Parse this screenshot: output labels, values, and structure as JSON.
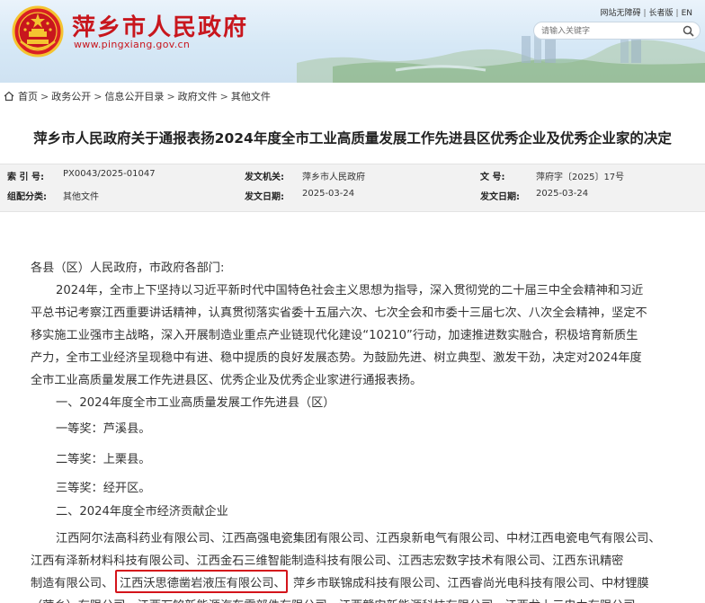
{
  "header": {
    "site_title": "萍乡市人民政府",
    "site_url": "www.pingxiang.gov.cn",
    "top_links": [
      "网站无障碍",
      "长者版",
      "EN"
    ],
    "search_placeholder": "请输入关键字",
    "brand_color": "#c8161d"
  },
  "breadcrumb": {
    "items": [
      "首页",
      "政务公开",
      "信息公开目录",
      "政府文件",
      "其他文件"
    ],
    "separator": ">"
  },
  "article": {
    "title": "萍乡市人民政府关于通报表扬2024年度全市工业高质量发展工作先进县区优秀企业及优秀企业家的决定"
  },
  "meta": {
    "index_label": "索 引 号:",
    "index_value": "PX0043/2025-01047",
    "issuer_label": "发文机关:",
    "issuer_value": "萍乡市人民政府",
    "docno_label": "文    号:",
    "docno_value": "萍府字〔2025〕17号",
    "category_label": "组配分类:",
    "category_value": "其他文件",
    "issue_date_label": "发文日期:",
    "issue_date_value": "2025-03-24",
    "publish_date_label": "发文日期:",
    "publish_date_value": "2025-03-24"
  },
  "body": {
    "salutation": "各县（区）人民政府，市政府各部门:",
    "para1": [
      "2024年，全市上下坚持以习近平新时代中国特色社会主义思想为指导，深入贯彻党的二十届三中全会精神和习近",
      "平总书记考察江西重要讲话精神，认真贯彻落实省委十五届六次、七次全会和市委十三届七次、八次全会精神，坚定不",
      "移实施工业强市主战略，深入开展制造业重点产业链现代化建设“10210”行动，加速推进数实融合，积极培育新质生",
      "产力，全市工业经济呈现稳中有进、稳中提质的良好发展态势。为鼓励先进、树立典型、激发干劲，决定对2024年度",
      "全市工业高质量发展工作先进县区、优秀企业及优秀企业家进行通报表扬。"
    ],
    "section1": "一、2024年度全市工业高质量发展工作先进县（区）",
    "award1": "一等奖：芦溪县。",
    "award2": "二等奖：上栗县。",
    "award3": "三等奖：经开区。",
    "section2": "二、2024年度全市经济贡献企业",
    "companies": [
      "江西阿尔法高科药业有限公司、江西高强电瓷集团有限公司、江西泉新电气有限公司、中材江西电瓷电气有限公司、",
      "江西有泽新材料科技有限公司、江西金石三维智能制造科技有限公司、江西志宏数字技术有限公司、江西东讯精密",
      "制造有限公司、",
      "江西沃思德凿岩液压有限公司、",
      "萍乡市联锦成科技有限公司、江西睿尚光电科技有限公司、中材锂膜",
      "（萍乡）有限公司、江西万铭新能源汽车零部件有限公司、江西赣安新能源科技有限公司、江西龙上元电力有限公司、"
    ]
  }
}
